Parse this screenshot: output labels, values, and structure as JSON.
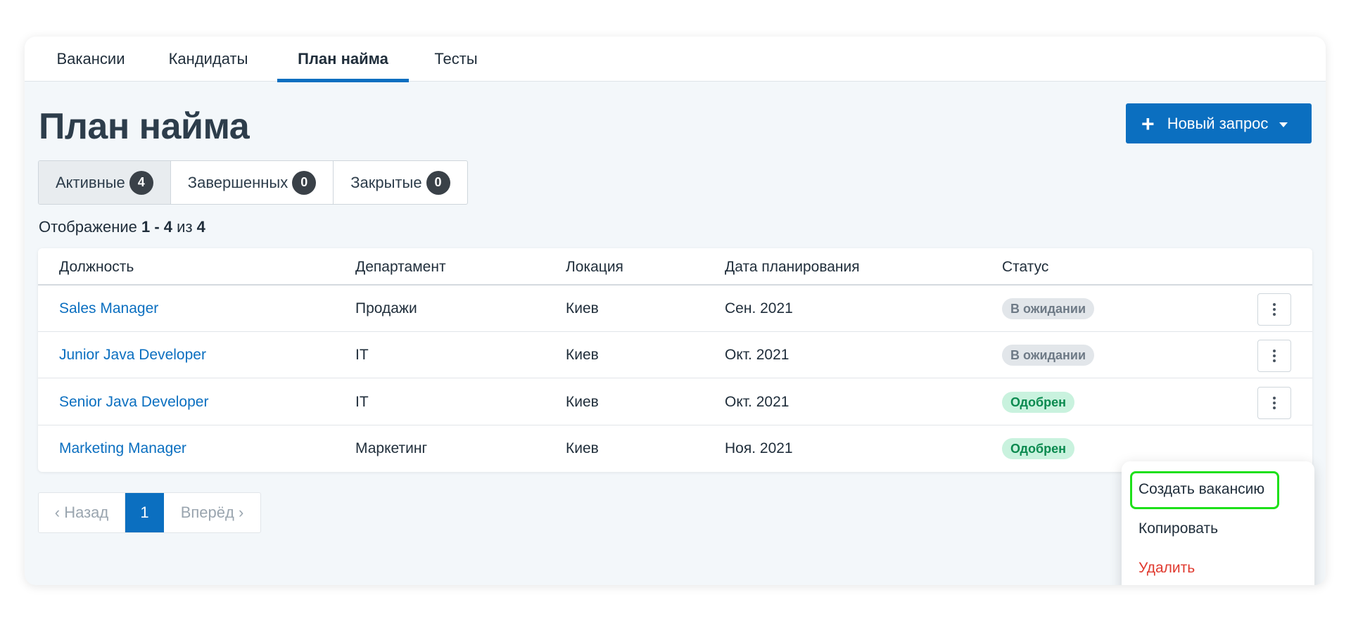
{
  "nav": {
    "tabs": [
      {
        "label": "Вакансии"
      },
      {
        "label": "Кандидаты"
      },
      {
        "label": "План найма"
      },
      {
        "label": "Тесты"
      }
    ]
  },
  "page": {
    "title": "План найма",
    "new_request_label": "Новый запрос"
  },
  "filters": [
    {
      "label": "Активные",
      "count": "4"
    },
    {
      "label": "Завершенных",
      "count": "0"
    },
    {
      "label": "Закрытые",
      "count": "0"
    }
  ],
  "showing": {
    "prefix": "Отображение",
    "range": "1 - 4",
    "of": "из",
    "total": "4"
  },
  "table": {
    "headers": [
      "Должность",
      "Департамент",
      "Локация",
      "Дата планирования",
      "Статус"
    ],
    "rows": [
      {
        "position": "Sales Manager",
        "department": "Продажи",
        "location": "Киев",
        "date": "Сен. 2021",
        "status": "В ожидании"
      },
      {
        "position": "Junior Java Developer",
        "department": "IT",
        "location": "Киев",
        "date": "Окт. 2021",
        "status": "В ожидании"
      },
      {
        "position": "Senior Java Developer",
        "department": "IT",
        "location": "Киев",
        "date": "Окт. 2021",
        "status": "Одобрен"
      },
      {
        "position": "Marketing Manager",
        "department": "Маркетинг",
        "location": "Киев",
        "date": "Ноя. 2021",
        "status": "Одобрен"
      }
    ]
  },
  "pagination": {
    "prev": "‹ Назад",
    "current": "1",
    "next": "Вперёд ›"
  },
  "context_menu": {
    "items": [
      "Создать вакансию",
      "Копировать",
      "Удалить"
    ]
  },
  "colors": {
    "accent": "#0b6fc0",
    "highlight": "#1ee01a",
    "danger": "#e03a2f",
    "approved": "#0a8a4f",
    "pending": "#6e7a86"
  },
  "icons": {
    "plus": "plus-icon",
    "caret": "chevron-down-icon",
    "kebab": "more-vertical-icon"
  }
}
